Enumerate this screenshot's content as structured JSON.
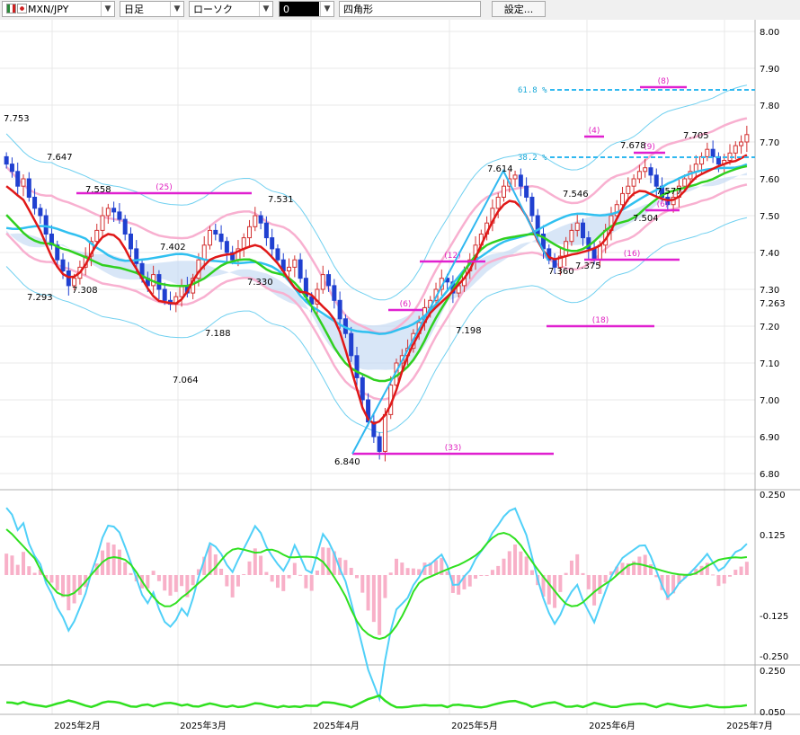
{
  "toolbar": {
    "symbol": "MXN/JPY",
    "timeframe": "日足",
    "chart_type": "ローソク",
    "color_value": "0",
    "drawing_tool": "四角形",
    "settings_label": "設定..."
  },
  "chart_data": {
    "type": "candlestick",
    "y_axis_main": [
      "8.00",
      "7.90",
      "7.80",
      "7.70",
      "7.60",
      "7.50",
      "7.40",
      "7.30",
      "7.20",
      "7.10",
      "7.00",
      "6.90",
      "6.80"
    ],
    "ylim_main": [
      6.78,
      8.01
    ],
    "y_axis_extra": [
      "7.263"
    ],
    "y_axis_macd": [
      "0.250",
      "0.125",
      "-0.125",
      "-0.250"
    ],
    "y_axis_sub": [
      "0.250",
      "0.050"
    ],
    "x_labels": [
      "2025年2月",
      "2025年3月",
      "2025年4月",
      "2025年5月",
      "2025年6月",
      "2025年7月"
    ],
    "price_labels": [
      "7.753",
      "7.647",
      "7.558",
      "7.293",
      "7.308",
      "7.402",
      "7.531",
      "7.330",
      "7.188",
      "7.064",
      "6.840",
      "7.198",
      "7.614",
      "7.360",
      "7.546",
      "7.375",
      "7.678",
      "7.504",
      "7.577",
      "7.705"
    ],
    "pattern_counts": [
      "(25)",
      "(6)",
      "(12)",
      "(33)",
      "(4)",
      "(9)",
      "(6)",
      "(16)",
      "(18)",
      "(8)"
    ],
    "fibonacci_labels": [
      "61.8 %",
      "38.2 %"
    ],
    "closes": [
      7.64,
      7.62,
      7.58,
      7.6,
      7.55,
      7.52,
      7.5,
      7.45,
      7.42,
      7.38,
      7.35,
      7.31,
      7.33,
      7.36,
      7.39,
      7.43,
      7.46,
      7.5,
      7.52,
      7.51,
      7.49,
      7.45,
      7.41,
      7.37,
      7.33,
      7.31,
      7.34,
      7.3,
      7.27,
      7.26,
      7.28,
      7.31,
      7.29,
      7.33,
      7.38,
      7.42,
      7.46,
      7.45,
      7.43,
      7.4,
      7.38,
      7.41,
      7.44,
      7.47,
      7.5,
      7.48,
      7.44,
      7.41,
      7.38,
      7.35,
      7.36,
      7.38,
      7.33,
      7.28,
      7.26,
      7.3,
      7.34,
      7.31,
      7.27,
      7.22,
      7.18,
      7.12,
      7.06,
      7.0,
      6.94,
      6.9,
      6.86,
      6.96,
      7.04,
      7.1,
      7.12,
      7.14,
      7.18,
      7.21,
      7.25,
      7.27,
      7.3,
      7.33,
      7.32,
      7.29,
      7.31,
      7.35,
      7.38,
      7.42,
      7.45,
      7.48,
      7.52,
      7.55,
      7.58,
      7.6,
      7.61,
      7.58,
      7.55,
      7.5,
      7.45,
      7.41,
      7.38,
      7.36,
      7.39,
      7.43,
      7.46,
      7.48,
      7.44,
      7.41,
      7.38,
      7.42,
      7.46,
      7.5,
      7.53,
      7.56,
      7.58,
      7.6,
      7.62,
      7.63,
      7.61,
      7.58,
      7.55,
      7.53,
      7.55,
      7.58,
      7.6,
      7.62,
      7.64,
      7.66,
      7.68,
      7.66,
      7.64,
      7.65,
      7.67,
      7.69,
      7.7,
      7.72
    ]
  }
}
